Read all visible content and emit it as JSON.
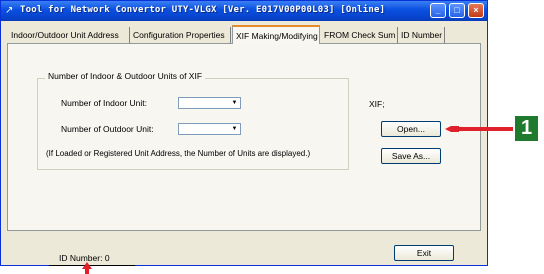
{
  "window": {
    "title": "Tool for Network Convertor UTY-VLGX [Ver. E017V00P00L03] [Online]",
    "minimize": "_",
    "maximize": "□",
    "close": "×"
  },
  "tabs": [
    {
      "label": "Indoor/Outdoor Unit Address"
    },
    {
      "label": "Configuration Properties"
    },
    {
      "label": "XIF Making/Modifying"
    },
    {
      "label": "FROM Check Sum"
    },
    {
      "label": "ID Number"
    }
  ],
  "active_tab": "XIF Making/Modifying",
  "group": {
    "legend": "Number of Indoor & Outdoor Units of XIF",
    "indoor_label": "Number of Indoor Unit:",
    "indoor_value": "",
    "outdoor_label": "Number of Outdoor Unit:",
    "outdoor_value": "",
    "note": "(If Loaded or Registered Unit Address, the Number of Units are displayed.)"
  },
  "xif_label": "XIF;",
  "buttons": {
    "open": "Open...",
    "save_as": "Save As...",
    "exit": "Exit"
  },
  "id_number": "ID Number:  0",
  "callout": {
    "badge": "1",
    "color": "#e0202a",
    "badge_color": "#1f7a2e"
  }
}
